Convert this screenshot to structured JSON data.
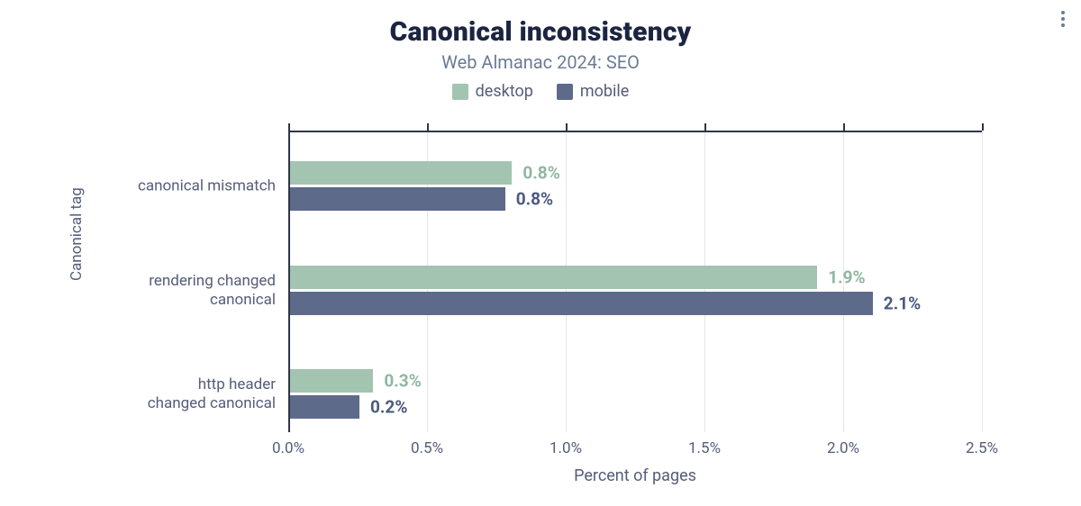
{
  "title": "Canonical inconsistency",
  "subtitle": "Web Almanac 2024: SEO",
  "legend": {
    "desktop": "desktop",
    "mobile": "mobile"
  },
  "ylabel": "Canonical tag",
  "xlabel": "Percent of pages",
  "xticks": [
    "0.0%",
    "0.5%",
    "1.0%",
    "1.5%",
    "2.0%",
    "2.5%"
  ],
  "colors": {
    "desktop": "#a3c4b1",
    "mobile": "#5e6a8a",
    "desktop_text": "#8fb8a1",
    "mobile_text": "#4c5a80",
    "axis": "#2d3648"
  },
  "categories": [
    {
      "label": "canonical mismatch",
      "desktop_label": "0.8%",
      "mobile_label": "0.8%"
    },
    {
      "label": "rendering changed canonical",
      "desktop_label": "1.9%",
      "mobile_label": "2.1%"
    },
    {
      "label": "http header changed canonical",
      "desktop_label": "0.3%",
      "mobile_label": "0.2%"
    }
  ],
  "chart_data": {
    "type": "bar",
    "orientation": "horizontal",
    "title": "Canonical inconsistency",
    "subtitle": "Web Almanac 2024: SEO",
    "xlabel": "Percent of pages",
    "ylabel": "Canonical tag",
    "xlim": [
      0.0,
      2.5
    ],
    "xticks": [
      0.0,
      0.5,
      1.0,
      1.5,
      2.0,
      2.5
    ],
    "grid": true,
    "legend_position": "top",
    "categories": [
      "canonical mismatch",
      "rendering changed canonical",
      "http header changed canonical"
    ],
    "series": [
      {
        "name": "desktop",
        "values": [
          0.8,
          1.9,
          0.3
        ],
        "color": "#a3c4b1"
      },
      {
        "name": "mobile",
        "values": [
          0.8,
          2.1,
          0.2
        ],
        "color": "#5e6a8a"
      }
    ]
  }
}
